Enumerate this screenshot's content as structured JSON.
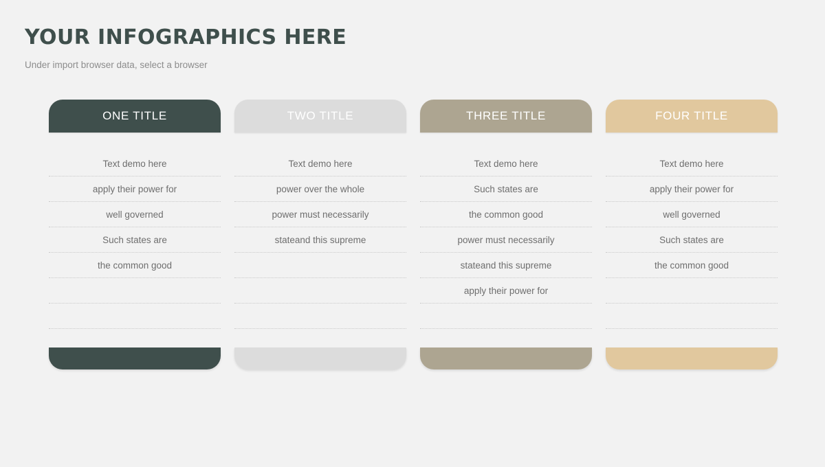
{
  "header": {
    "title": "YOUR INFOGRAPHICS HERE",
    "subtitle": "Under import browser data, select a browser",
    "title_color": "#3f4f4c",
    "subtitle_color": "#8c8c8c"
  },
  "background_color": "#f2f2f2",
  "columns": [
    {
      "title": "ONE TITLE",
      "color": "#3f4f4c",
      "title_color": "#ffffff",
      "rows": [
        "Text demo here",
        "apply their power for",
        "well governed",
        "Such states are",
        "the common good",
        "",
        ""
      ]
    },
    {
      "title": "TWO TITLE",
      "color": "#dcdcdc",
      "title_color": "#ffffff",
      "rows": [
        "Text demo here",
        "power over the whole",
        "power must necessarily",
        "stateand this supreme",
        "",
        "",
        ""
      ]
    },
    {
      "title": "THREE TITLE",
      "color": "#ada591",
      "title_color": "#ffffff",
      "rows": [
        "Text demo here",
        "Such states are",
        "the common good",
        "power must necessarily",
        "stateand this supreme",
        "apply their power for",
        ""
      ]
    },
    {
      "title": "FOUR TITLE",
      "color": "#e1c89e",
      "title_color": "#ffffff",
      "rows": [
        "Text demo here",
        "apply their power for",
        "well governed",
        "Such states are",
        "the common good",
        "",
        ""
      ]
    }
  ]
}
